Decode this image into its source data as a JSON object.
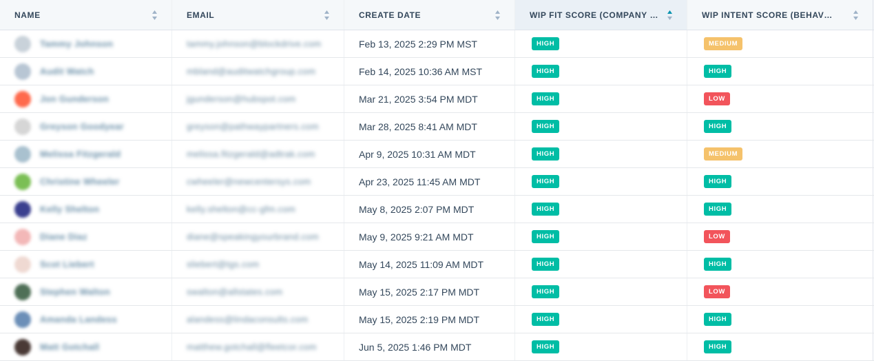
{
  "columns": [
    {
      "label": "NAME",
      "sort": "none"
    },
    {
      "label": "EMAIL",
      "sort": "none"
    },
    {
      "label": "CREATE DATE",
      "sort": "none"
    },
    {
      "label": "WIP FIT SCORE (COMPANY +...",
      "sort": "ascending"
    },
    {
      "label": "WIP INTENT SCORE (BEHAVIOR...",
      "sort": "none"
    }
  ],
  "colors": {
    "high": "#00bda5",
    "medium": "#f5c26b",
    "low": "#f2545b",
    "sorted_header": "#eaf0f6"
  },
  "rows": [
    {
      "name": "Tammy Johnson",
      "email": "tammy.johnson@blockdrive.com",
      "avatar_color": "#c9d2da",
      "create_date": "Feb 13, 2025 2:29 PM MST",
      "fit": "HIGH",
      "intent": "MEDIUM"
    },
    {
      "name": "Audit Watch",
      "email": "mbland@auditwatchgroup.com",
      "avatar_color": "#b8c6d4",
      "create_date": "Feb 14, 2025 10:36 AM MST",
      "fit": "HIGH",
      "intent": "HIGH"
    },
    {
      "name": "Jon Gunderson",
      "email": "jgunderson@hubspot.com",
      "avatar_color": "#ff6a4d",
      "create_date": "Mar 21, 2025 3:54 PM MDT",
      "fit": "HIGH",
      "intent": "LOW"
    },
    {
      "name": "Greyson Goodyear",
      "email": "greyson@pathwaypartners.com",
      "avatar_color": "#d6d6d6",
      "create_date": "Mar 28, 2025 8:41 AM MDT",
      "fit": "HIGH",
      "intent": "HIGH"
    },
    {
      "name": "Melissa Fitzgerald",
      "email": "melissa.fitzgerald@adtrak.com",
      "avatar_color": "#a9c1cf",
      "create_date": "Apr 9, 2025 10:31 AM MDT",
      "fit": "HIGH",
      "intent": "MEDIUM"
    },
    {
      "name": "Christine Wheeler",
      "email": "cwheeler@newcentersys.com",
      "avatar_color": "#7bbf55",
      "create_date": "Apr 23, 2025 11:45 AM MDT",
      "fit": "HIGH",
      "intent": "HIGH"
    },
    {
      "name": "Kelly Shelton",
      "email": "kelly.shelton@cc-gfm.com",
      "avatar_color": "#3a3f8f",
      "create_date": "May 8, 2025 2:07 PM MDT",
      "fit": "HIGH",
      "intent": "HIGH"
    },
    {
      "name": "Diane Diaz",
      "email": "diane@speakingyourbrand.com",
      "avatar_color": "#f3b8b8",
      "create_date": "May 9, 2025 9:21 AM MDT",
      "fit": "HIGH",
      "intent": "LOW"
    },
    {
      "name": "Scot Liebert",
      "email": "sliebert@tgs.com",
      "avatar_color": "#efd9d2",
      "create_date": "May 14, 2025 11:09 AM MDT",
      "fit": "HIGH",
      "intent": "HIGH"
    },
    {
      "name": "Stephen Walton",
      "email": "swalton@allstates.com",
      "avatar_color": "#4f6f57",
      "create_date": "May 15, 2025 2:17 PM MDT",
      "fit": "HIGH",
      "intent": "LOW"
    },
    {
      "name": "Amanda Landess",
      "email": "alandess@lindaconsults.com",
      "avatar_color": "#6c8fb8",
      "create_date": "May 15, 2025 2:19 PM MDT",
      "fit": "HIGH",
      "intent": "HIGH"
    },
    {
      "name": "Matt Gotchall",
      "email": "matthew.gotchall@fleetcor.com",
      "avatar_color": "#4a3a36",
      "create_date": "Jun 5, 2025 1:46 PM MDT",
      "fit": "HIGH",
      "intent": "HIGH"
    }
  ]
}
